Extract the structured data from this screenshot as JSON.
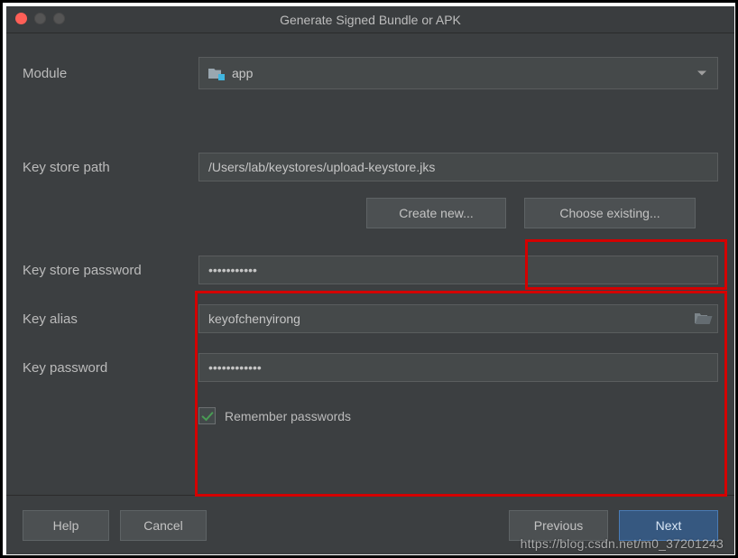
{
  "title": "Generate Signed Bundle or APK",
  "module": {
    "label": "Module",
    "selected": "app"
  },
  "keystore_path": {
    "label": "Key store path",
    "value": "/Users/lab/keystores/upload-keystore.jks"
  },
  "buttons": {
    "create_new": "Create new...",
    "choose_existing": "Choose existing..."
  },
  "keystore_password": {
    "label": "Key store password",
    "value": "keystorepw1"
  },
  "key_alias": {
    "label": "Key alias",
    "value": "keyofchenyirong"
  },
  "key_password": {
    "label": "Key password",
    "value": "keypassword1"
  },
  "remember": {
    "label": "Remember passwords",
    "checked": true
  },
  "footer": {
    "help": "Help",
    "cancel": "Cancel",
    "previous": "Previous",
    "next": "Next"
  },
  "watermark": "https://blog.csdn.net/m0_37201243"
}
